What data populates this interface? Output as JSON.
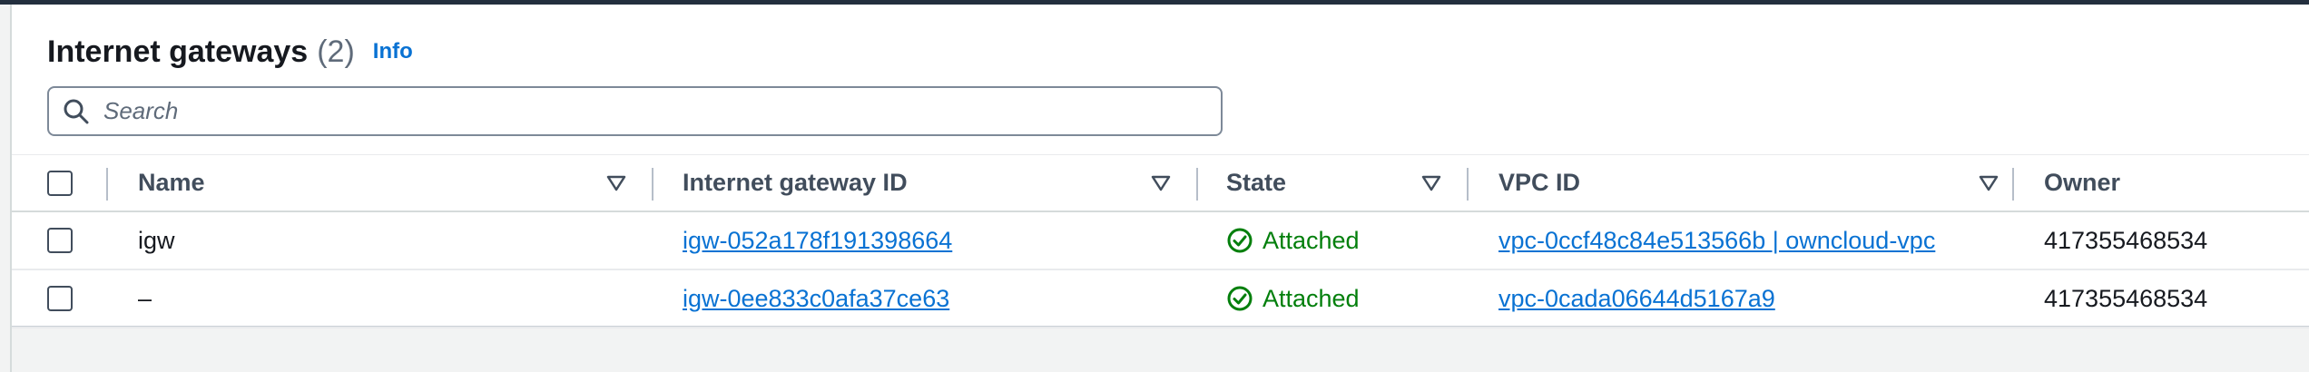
{
  "header": {
    "title": "Internet gateways",
    "count": "(2)",
    "info_label": "Info"
  },
  "search": {
    "placeholder": "Search"
  },
  "table": {
    "columns": [
      "Name",
      "Internet gateway ID",
      "State",
      "VPC ID",
      "Owner"
    ],
    "rows": [
      {
        "name": "igw",
        "gateway_id": "igw-052a178f191398664",
        "state": "Attached",
        "vpc_id": "vpc-0ccf48c84e513566b | owncloud-vpc",
        "owner": "417355468534"
      },
      {
        "name": "–",
        "gateway_id": "igw-0ee833c0afa37ce63",
        "state": "Attached",
        "vpc_id": "vpc-0cada06644d5167a9",
        "owner": "417355468534"
      }
    ]
  },
  "colors": {
    "link": "#0972d3",
    "success": "#037f0c",
    "header_bar": "#232f3e"
  },
  "icons": {
    "search": "search-icon",
    "sort": "sort-caret-icon",
    "status": "check-circle-icon"
  }
}
